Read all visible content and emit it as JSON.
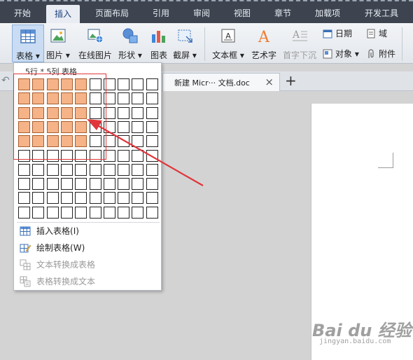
{
  "menu_tabs": [
    "开始",
    "插入",
    "页面布局",
    "引用",
    "审阅",
    "视图",
    "章节",
    "加载项",
    "开发工具"
  ],
  "active_tab": "插入",
  "ribbon": {
    "table": "表格",
    "picture": "图片",
    "online_picture": "在线图片",
    "shape": "形状",
    "chart": "图表",
    "screenshot": "截屏",
    "textbox": "文本框",
    "wordart": "艺术字",
    "dropcap": "首字下沉",
    "date": "日期",
    "field": "域",
    "object": "对象",
    "attachment": "附件"
  },
  "doc_tab": {
    "title": "新建 Micr··· 文档.doc",
    "close": "×",
    "add": "+"
  },
  "dropdown": {
    "title": "5行 * 5列 表格",
    "rows": 10,
    "cols": 10,
    "selected_rows": 5,
    "selected_cols": 5,
    "items": [
      {
        "label": "插入表格",
        "accel": "(I)",
        "enabled": true
      },
      {
        "label": "绘制表格",
        "accel": "(W)",
        "enabled": true
      },
      {
        "label": "文本转换成表格",
        "accel": "",
        "enabled": false
      },
      {
        "label": "表格转换成文本",
        "accel": "",
        "enabled": false
      }
    ]
  },
  "watermark": {
    "brand": "Bai du 经验",
    "url": "jingyan.baidu.com"
  },
  "colors": {
    "highlight_cell": "#f5b387",
    "annotation": "#e0353a",
    "menubar": "#3d4450"
  }
}
